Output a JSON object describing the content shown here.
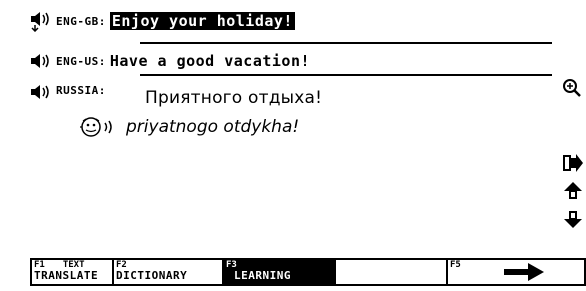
{
  "entries": [
    {
      "lang": "ENG-GB:",
      "phrase": "Enjoy your holiday!",
      "selected": true,
      "icon": "speaker-with-arrows-icon"
    },
    {
      "lang": "ENG-US:",
      "phrase": "Have a good vacation!",
      "selected": false,
      "icon": "speaker-icon"
    },
    {
      "lang": "RUSSIA:",
      "phrase": "Приятного отдыха!",
      "selected": false,
      "icon": "speaker-icon"
    }
  ],
  "transliteration": {
    "icon": "speaking-head-icon",
    "text": "priyatnogo otdykha!"
  },
  "side_icons": [
    "zoom-icon",
    "export-arrow-icon",
    "page-up-icon",
    "page-down-icon"
  ],
  "function_keys": [
    {
      "num": "F1",
      "label1": "TEXT",
      "label2": "TRANSLATE",
      "active": false
    },
    {
      "num": "F2",
      "label1": "",
      "label2": "DICTIONARY",
      "active": false
    },
    {
      "num": "F3",
      "label1": "",
      "label2": "LEARNING",
      "active": true
    },
    {
      "num": "",
      "label1": "",
      "label2": "",
      "active": false
    },
    {
      "num": "F5",
      "label1": "",
      "label2": "",
      "active": false,
      "icon": "right-arrow-icon"
    }
  ]
}
